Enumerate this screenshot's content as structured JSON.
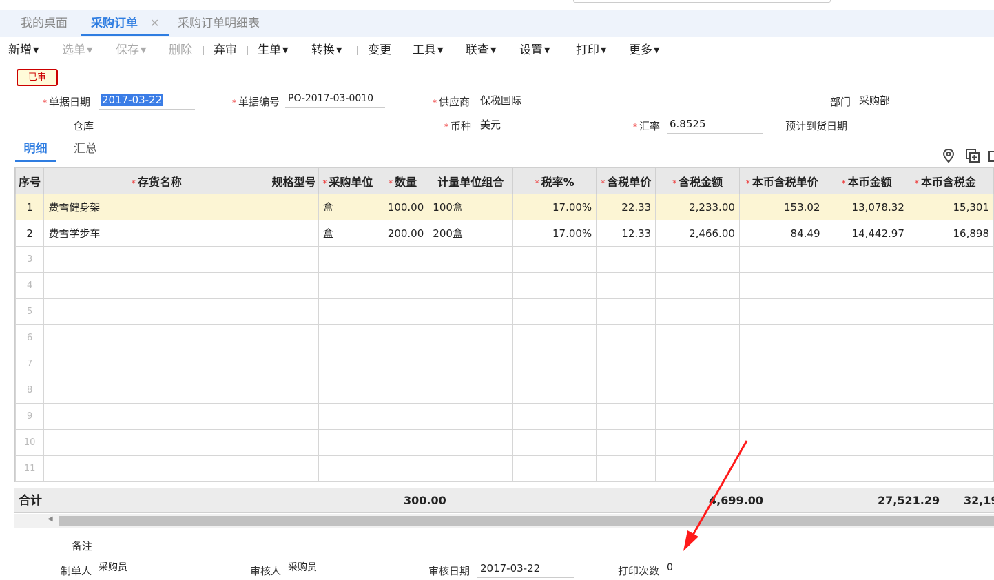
{
  "tabs": [
    {
      "label": "我的桌面",
      "active": false
    },
    {
      "label": "采购订单",
      "active": true,
      "close": "✕"
    },
    {
      "label": "采购订单明细表",
      "active": false
    }
  ],
  "toolbar": {
    "new": "新增",
    "select": "选单",
    "save": "保存",
    "delete": "删除",
    "abandon": "弃审",
    "generate": "生单",
    "convert": "转换",
    "change": "变更",
    "tools": "工具",
    "query": "联查",
    "settings": "设置",
    "print": "打印",
    "more": "更多"
  },
  "status_badge": "已审",
  "form": {
    "date_label": "单据日期",
    "date_value": "2017-03-22",
    "code_label": "单据编号",
    "code_value": "PO-2017-03-0010",
    "supplier_label": "供应商",
    "supplier_value": "保税国际",
    "dept_label": "部门",
    "dept_value": "采购部",
    "warehouse_label": "仓库",
    "warehouse_value": "",
    "currency_label": "币种",
    "currency_value": "美元",
    "rate_label": "汇率",
    "rate_value": "6.8525",
    "arrival_label": "预计到货日期",
    "arrival_value": ""
  },
  "subtabs": {
    "detail": "明细",
    "summary": "汇总"
  },
  "table": {
    "headers": [
      "序号",
      "存货名称",
      "规格型号",
      "采购单位",
      "数量",
      "计量单位组合",
      "税率%",
      "含税单价",
      "含税金额",
      "本币含税单价",
      "本币金额",
      "本币含税金"
    ],
    "rows": [
      [
        "1",
        "费雪健身架",
        "",
        "盒",
        "100.00",
        "100盒",
        "17.00%",
        "22.33",
        "2,233.00",
        "153.02",
        "13,078.32",
        "15,301"
      ],
      [
        "2",
        "费雪学步车",
        "",
        "盒",
        "200.00",
        "200盒",
        "17.00%",
        "12.33",
        "2,466.00",
        "84.49",
        "14,442.97",
        "16,898"
      ]
    ],
    "empty_rows": [
      "3",
      "4",
      "5",
      "6",
      "7",
      "8",
      "9",
      "10",
      "11"
    ]
  },
  "totals": {
    "label": "合计",
    "qty": "300.00",
    "amount": "4,699.00",
    "local_amount": "27,521.29",
    "local_tax": "32,19"
  },
  "footer": {
    "remark_label": "备注",
    "remark_value": "",
    "creator_label": "制单人",
    "creator_value": "采购员",
    "auditor_label": "审核人",
    "auditor_value": "采购员",
    "audit_date_label": "审核日期",
    "audit_date_value": "2017-03-22",
    "print_count_label": "打印次数",
    "print_count_value": "0"
  },
  "colors": {
    "accent": "#2f7de1",
    "required": "#e33",
    "badge": "#c00",
    "highlight_row": "#fcf5d4",
    "annotation_arrow": "#ff1a1a"
  }
}
